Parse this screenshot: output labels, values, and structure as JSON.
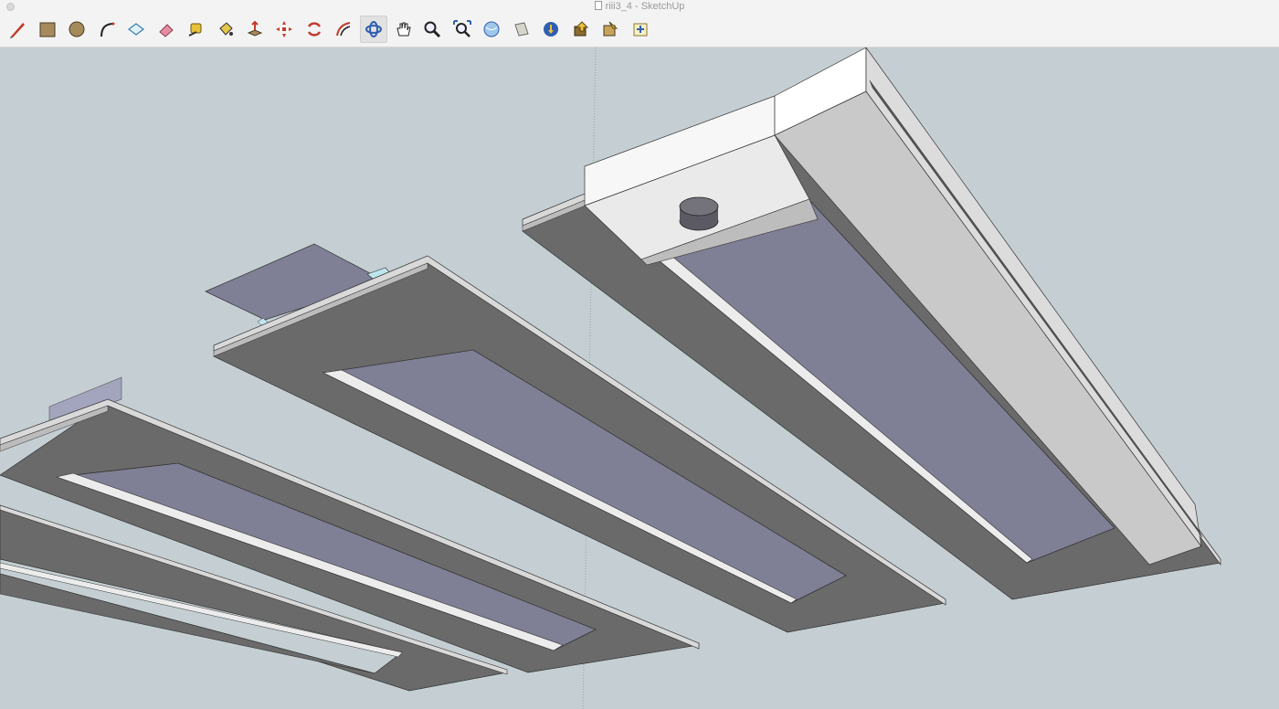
{
  "window": {
    "title": "riii3_4 - SketchUp"
  },
  "toolbar": {
    "tools": [
      {
        "name": "pencil-icon",
        "label": "Line"
      },
      {
        "name": "rectangle-icon",
        "label": "Rectangle"
      },
      {
        "name": "circle-icon",
        "label": "Circle"
      },
      {
        "name": "arc-icon",
        "label": "Arc"
      },
      {
        "name": "make-component-icon",
        "label": "Make Component"
      },
      {
        "name": "eraser-icon",
        "label": "Eraser"
      },
      {
        "name": "tape-measure-icon",
        "label": "Tape Measure"
      },
      {
        "name": "paint-bucket-icon",
        "label": "Paint Bucket"
      },
      {
        "name": "push-pull-icon",
        "label": "Push/Pull"
      },
      {
        "name": "move-icon",
        "label": "Move"
      },
      {
        "name": "rotate-icon",
        "label": "Rotate"
      },
      {
        "name": "offset-icon",
        "label": "Offset"
      },
      {
        "name": "orbit-icon",
        "label": "Orbit"
      },
      {
        "name": "pan-icon",
        "label": "Pan"
      },
      {
        "name": "zoom-icon",
        "label": "Zoom"
      },
      {
        "name": "zoom-extents-icon",
        "label": "Zoom Extents"
      },
      {
        "name": "warehouse-icon",
        "label": "3D Warehouse"
      },
      {
        "name": "share-model-icon",
        "label": "Share Model"
      },
      {
        "name": "get-models-icon",
        "label": "Get Models"
      },
      {
        "name": "extension-warehouse-icon",
        "label": "Extension Warehouse"
      },
      {
        "name": "share-component-icon",
        "label": "Share Component"
      },
      {
        "name": "layout-icon",
        "label": "Send to LayOut"
      }
    ],
    "active_tool": "orbit-icon"
  },
  "colors": {
    "viewport_bg": "#c5cfd3",
    "frame_top": "#6a6a6a",
    "frame_rim": "#d6d6d6",
    "glass": "#7f7f95",
    "housing": "#e8e8e8",
    "copper": "#c97842",
    "cyan": "#bfe6ef"
  }
}
